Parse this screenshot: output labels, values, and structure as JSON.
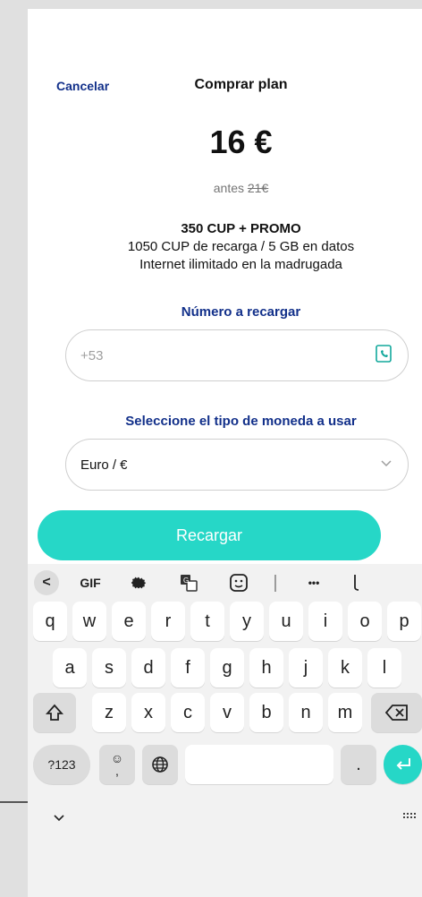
{
  "header": {
    "cancel_label": "Cancelar",
    "title": "Comprar plan"
  },
  "price": {
    "current": "16 €",
    "before_prefix": "antes ",
    "before_value": "21€"
  },
  "plan": {
    "name": "350 CUP + PROMO",
    "line1": "1050 CUP de recarga / 5 GB en datos",
    "line2": "Internet ilimitado en la madrugada"
  },
  "phone_section": {
    "label": "Número a recargar",
    "placeholder": "+53",
    "icon": "contact-phone-icon"
  },
  "currency_section": {
    "label": "Seleccione el tipo de moneda a usar",
    "selected": "Euro / €",
    "icon": "chevron-down-icon"
  },
  "submit": {
    "label": "Recargar"
  },
  "keyboard": {
    "toolbar": {
      "back": "<",
      "gif": "GIF",
      "settings_icon": "gear-icon",
      "translate_icon": "translate-icon",
      "sticker_icon": "sticker-icon",
      "more": "•••",
      "mic_icon": "mic-icon"
    },
    "row1": [
      "q",
      "w",
      "e",
      "r",
      "t",
      "y",
      "u",
      "i",
      "o",
      "p"
    ],
    "row2": [
      "a",
      "s",
      "d",
      "f",
      "g",
      "h",
      "j",
      "k",
      "l"
    ],
    "row3": [
      "z",
      "x",
      "c",
      "v",
      "b",
      "n",
      "m"
    ],
    "shift_icon": "shift-icon",
    "backspace_icon": "backspace-icon",
    "symbols_label": "?123",
    "emoji_label": "☺",
    "comma_label": ",",
    "globe_icon": "globe-icon",
    "period_label": ".",
    "enter_icon": "enter-icon",
    "hide_icon": "chevron-down-icon",
    "layout_icon": "keyboard-icon"
  }
}
